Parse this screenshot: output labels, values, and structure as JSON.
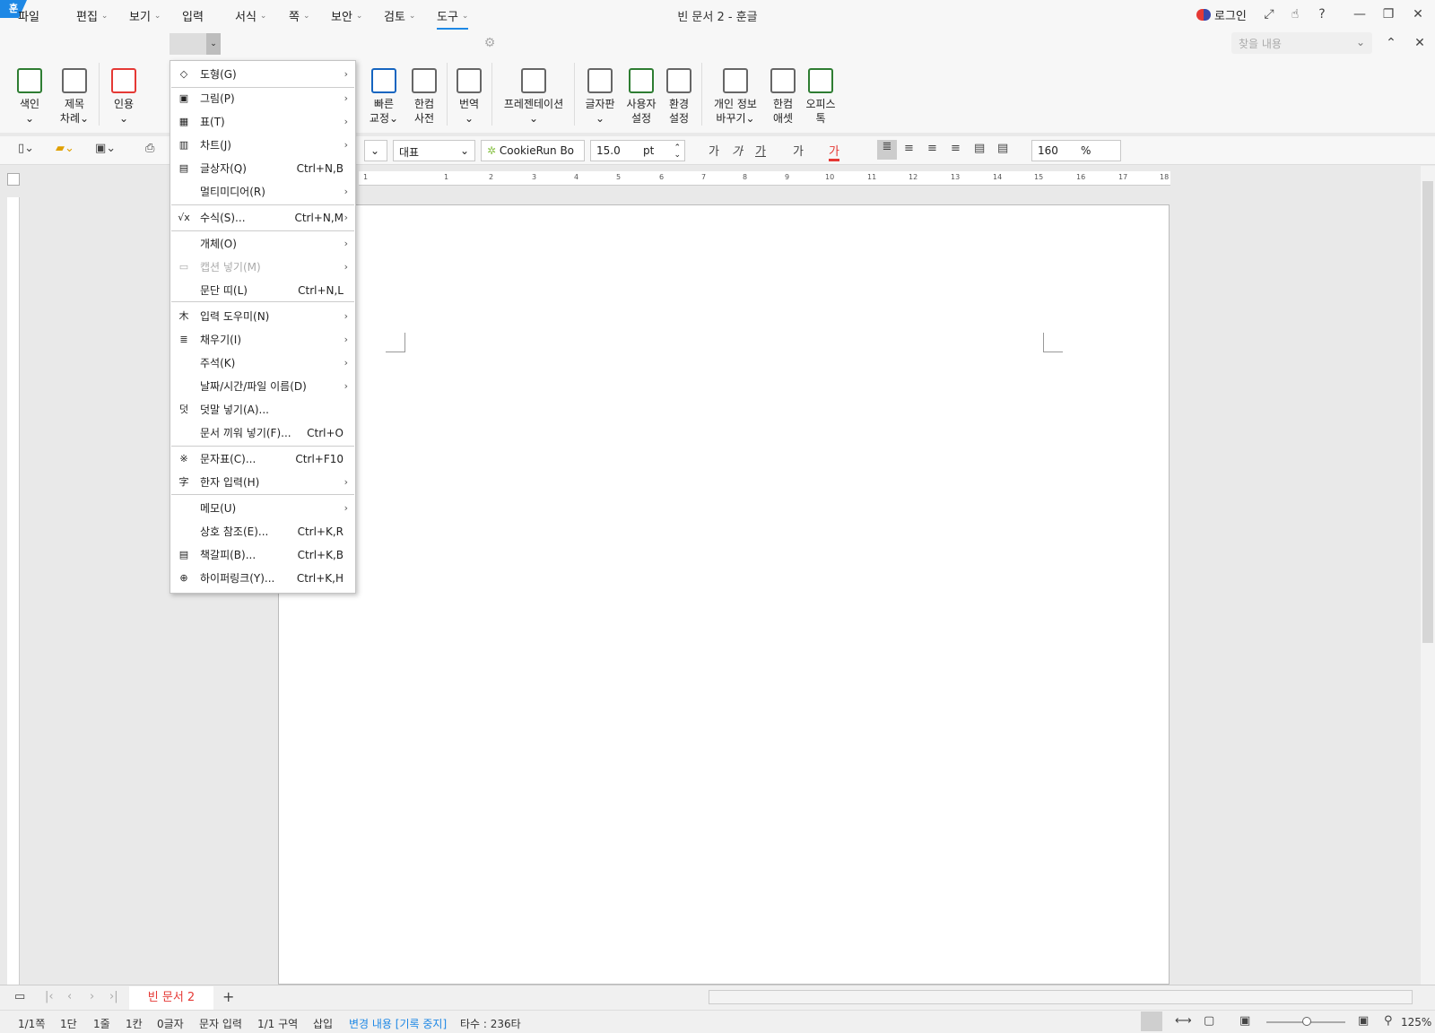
{
  "window": {
    "title": "빈 문서 2 - 훈글",
    "logo": "훈",
    "login": "로그인"
  },
  "menubar": {
    "items": [
      {
        "label": "파일",
        "chev": false
      },
      {
        "label": "편집",
        "chev": true
      },
      {
        "label": "보기",
        "chev": true
      },
      {
        "label": "입력",
        "chev": true
      },
      {
        "label": "서식",
        "chev": true
      },
      {
        "label": "쪽",
        "chev": true
      },
      {
        "label": "보안",
        "chev": true
      },
      {
        "label": "검토",
        "chev": true
      },
      {
        "label": "도구",
        "chev": true
      }
    ],
    "search_placeholder": "찾을 내용"
  },
  "ribbon": {
    "items": [
      {
        "l1": "색인",
        "l2": "⌄"
      },
      {
        "l1": "제목",
        "l2": "차례⌄"
      },
      {
        "l1": "인용",
        "l2": "⌄"
      },
      {
        "l1": "빠른",
        "l2": "교정⌄"
      },
      {
        "l1": "한컴",
        "l2": "사전"
      },
      {
        "l1": "번역",
        "l2": "⌄"
      },
      {
        "l1": "프레젠테이션",
        "l2": "⌄"
      },
      {
        "l1": "글자판",
        "l2": "⌄"
      },
      {
        "l1": "사용자",
        "l2": "설정"
      },
      {
        "l1": "환경",
        "l2": "설정"
      },
      {
        "l1": "개인 정보",
        "l2": "바꾸기⌄"
      },
      {
        "l1": "한컴",
        "l2": "애셋"
      },
      {
        "l1": "오피스",
        "l2": "톡"
      }
    ]
  },
  "format": {
    "style": "대표",
    "font": "CookieRun Bo",
    "size": "15.0",
    "unit": "pt",
    "spacing": "160",
    "spacing_unit": "%",
    "ga": "가"
  },
  "dropdown": {
    "items": [
      {
        "label": "도형(G)",
        "shortcut": "",
        "sub": true,
        "icon": "◇",
        "dis": false
      },
      {
        "label": "그림(P)",
        "shortcut": "",
        "sub": true,
        "icon": "▣",
        "dis": false
      },
      {
        "label": "표(T)",
        "shortcut": "",
        "sub": true,
        "icon": "▦",
        "dis": false
      },
      {
        "label": "차트(J)",
        "shortcut": "",
        "sub": true,
        "icon": "▥",
        "dis": false
      },
      {
        "label": "글상자(Q)",
        "shortcut": "Ctrl+N,B",
        "sub": false,
        "icon": "▤",
        "dis": false
      },
      {
        "label": "멀티미디어(R)",
        "shortcut": "",
        "sub": true,
        "icon": "",
        "dis": false
      },
      {
        "label": "수식(S)...",
        "shortcut": "Ctrl+N,M",
        "sub": true,
        "icon": "√x",
        "dis": false
      },
      {
        "label": "개체(O)",
        "shortcut": "",
        "sub": true,
        "icon": "",
        "dis": false
      },
      {
        "label": "캡션 넣기(M)",
        "shortcut": "",
        "sub": true,
        "icon": "▭",
        "dis": true
      },
      {
        "label": "문단 띠(L)",
        "shortcut": "Ctrl+N,L",
        "sub": false,
        "icon": "",
        "dis": false
      },
      {
        "label": "입력 도우미(N)",
        "shortcut": "",
        "sub": true,
        "icon": "木",
        "dis": false
      },
      {
        "label": "채우기(I)",
        "shortcut": "",
        "sub": true,
        "icon": "≣",
        "dis": false
      },
      {
        "label": "주석(K)",
        "shortcut": "",
        "sub": true,
        "icon": "",
        "dis": false
      },
      {
        "label": "날짜/시간/파일 이름(D)",
        "shortcut": "",
        "sub": true,
        "icon": "",
        "dis": false
      },
      {
        "label": "덧말 넣기(A)...",
        "shortcut": "",
        "sub": false,
        "icon": "덧",
        "dis": false
      },
      {
        "label": "문서 끼워 넣기(F)...",
        "shortcut": "Ctrl+O",
        "sub": false,
        "icon": "",
        "dis": false
      },
      {
        "label": "문자표(C)...",
        "shortcut": "Ctrl+F10",
        "sub": false,
        "icon": "※",
        "dis": false
      },
      {
        "label": "한자 입력(H)",
        "shortcut": "",
        "sub": true,
        "icon": "字",
        "dis": false
      },
      {
        "label": "메모(U)",
        "shortcut": "",
        "sub": true,
        "icon": "",
        "dis": false
      },
      {
        "label": "상호 참조(E)...",
        "shortcut": "Ctrl+K,R",
        "sub": false,
        "icon": "",
        "dis": false
      },
      {
        "label": "책갈피(B)...",
        "shortcut": "Ctrl+K,B",
        "sub": false,
        "icon": "▤",
        "dis": false
      },
      {
        "label": "하이퍼링크(Y)...",
        "shortcut": "Ctrl+K,H",
        "sub": false,
        "icon": "⊕",
        "dis": false
      }
    ]
  },
  "doctab": {
    "label": "빈 문서 2",
    "add": "+"
  },
  "status": {
    "items": [
      "1/1쪽",
      "1단",
      "1줄",
      "1칸",
      "0글자",
      "문자 입력",
      "1/1 구역",
      "삽입",
      "변경 내용 [기록 중지]",
      "타수 : 236타"
    ],
    "zoom": "125%",
    "accent": "#1e88e5"
  }
}
